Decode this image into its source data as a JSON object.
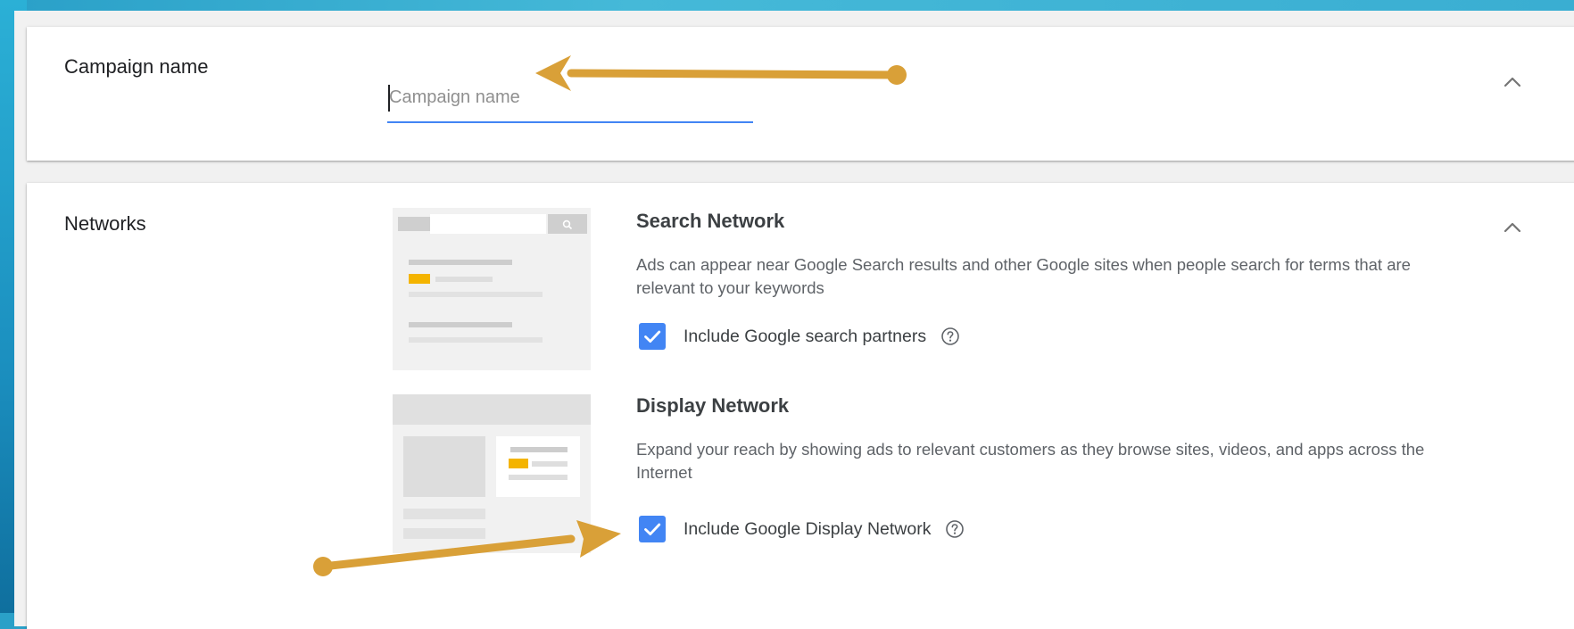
{
  "campaign": {
    "section_label": "Campaign name",
    "input_value": "",
    "input_placeholder": "Campaign name"
  },
  "networks": {
    "section_label": "Networks",
    "search": {
      "title": "Search Network",
      "description": "Ads can appear near Google Search results and other Google sites when people search for terms that are relevant to your keywords",
      "checkbox_label": "Include Google search partners",
      "checked": true
    },
    "display": {
      "title": "Display Network",
      "description": "Expand your reach by showing ads to relevant customers as they browse sites, videos, and apps across the Internet",
      "checkbox_label": "Include Google Display Network",
      "checked": true
    }
  },
  "icons": {
    "collapse": "chevron-up-icon",
    "help": "help-circle-icon",
    "check": "check-icon"
  },
  "colors": {
    "accent_blue": "#4285f4",
    "annotation_arrow": "#d9a038",
    "illustration_highlight": "#f4b400",
    "background_teal": "#3aaed2"
  }
}
